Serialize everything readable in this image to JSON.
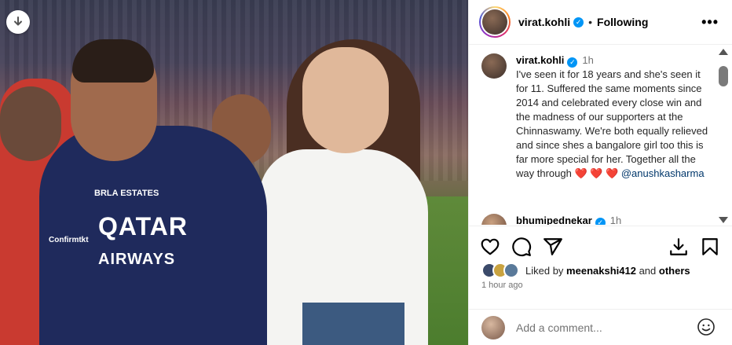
{
  "post": {
    "username": "virat.kohli",
    "follow_status": "Following",
    "more_label": "•••"
  },
  "photo": {
    "jersey_brand": "QATAR",
    "jersey_brand2": "AIRWAYS",
    "jersey_sponsor": "BRLA ESTATES",
    "jersey_side": "Confirmtkt"
  },
  "caption": {
    "username": "virat.kohli",
    "time": "1h",
    "text": "I've seen it for 18 years and she's seen it for 11. Suffered the same moments since 2014 and celebrated every close win and the madness of our supporters at the Chinnaswamy. We're both equally relieved and since shes a bangalore girl too this is far more special for her. Together all the way through ",
    "hearts": "❤️ ❤️ ❤️",
    "mention": "@anushkasharma"
  },
  "next_comment": {
    "username": "bhumipednekar",
    "time": "1h"
  },
  "likes": {
    "prefix": "Liked by",
    "user": "meenakshi412",
    "middle": "and",
    "others": "others"
  },
  "timestamp": "1 hour ago",
  "comment_box": {
    "placeholder": "Add a comment..."
  },
  "colors": {
    "verified": "#0095f6",
    "link": "#00376b",
    "muted": "#737373",
    "heart": "#ed4956"
  },
  "icons": [
    "download-icon",
    "verified-icon",
    "more-icon",
    "heart-icon",
    "comment-icon",
    "share-icon",
    "save-to-device-icon",
    "bookmark-icon",
    "emoji-icon"
  ]
}
